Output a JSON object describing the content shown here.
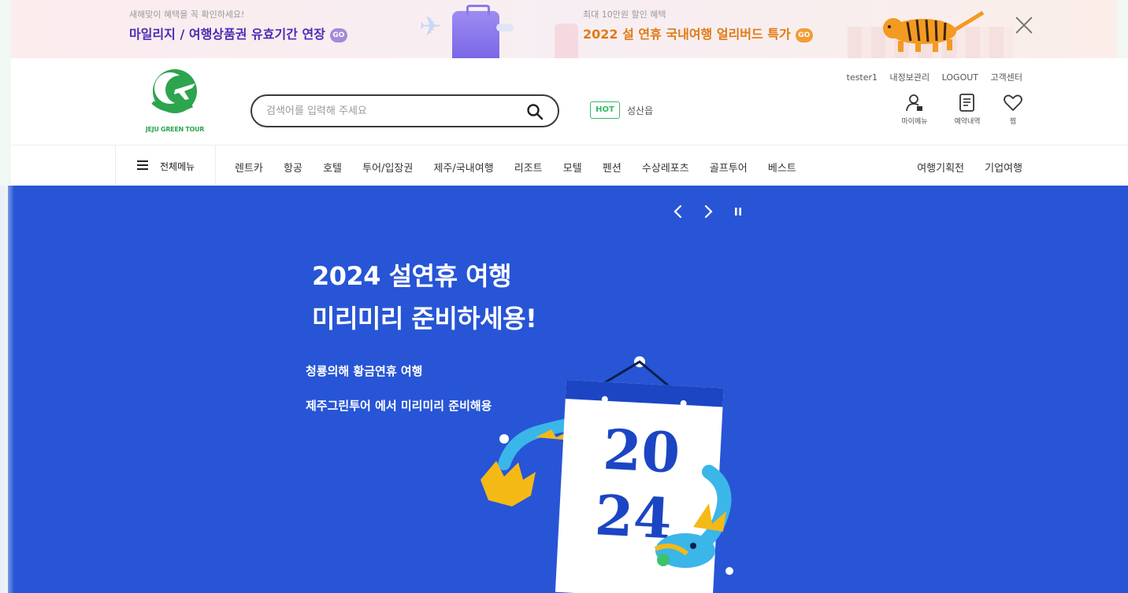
{
  "promo": {
    "left_caption": "새해맞이 혜택을 꼭 확인하세요!",
    "left_text": "마일리지 / 여행상품권 유효기간 연장",
    "right_caption": "최대 10만원 할인 혜택",
    "right_text": "2022 설 연휴 국내여행 얼리버드 특가",
    "go_label": "GO"
  },
  "header": {
    "logo_text": "JEJU GREEN TOUR",
    "search_placeholder": "검색어를 입력해 주세요",
    "hot_label": "HOT",
    "hot_keyword": "성산읍",
    "util_links": [
      "tester1",
      "내정보관리",
      "LOGOUT",
      "고객센터"
    ],
    "icons": [
      {
        "name": "user-icon",
        "label": "마이메뉴"
      },
      {
        "name": "document-icon",
        "label": "예약내역"
      },
      {
        "name": "heart-icon",
        "label": "찜"
      }
    ]
  },
  "nav": {
    "all_menu": "전체메뉴",
    "items": [
      "렌트카",
      "항공",
      "호텔",
      "투어/입장권",
      "제주/국내여행",
      "리조트",
      "모텔",
      "펜션",
      "수상레포츠",
      "골프투어",
      "베스트"
    ],
    "right_items": [
      "여행기획전",
      "기업여행"
    ]
  },
  "hero": {
    "title_line1": "2024 설연휴 여행",
    "title_line2": "미리미리 준비하세용!",
    "sub_line1": "청룡의해 황금연휴 여행",
    "sub_line2": "제주그린투어 에서 미리미리 준비해용",
    "calendar_top": "20",
    "calendar_bottom": "24"
  },
  "colors": {
    "hero_bg": "#2755d6",
    "brand_green": "#2da44e",
    "promo_purple": "#4b2bb3",
    "promo_orange": "#e07a12"
  }
}
